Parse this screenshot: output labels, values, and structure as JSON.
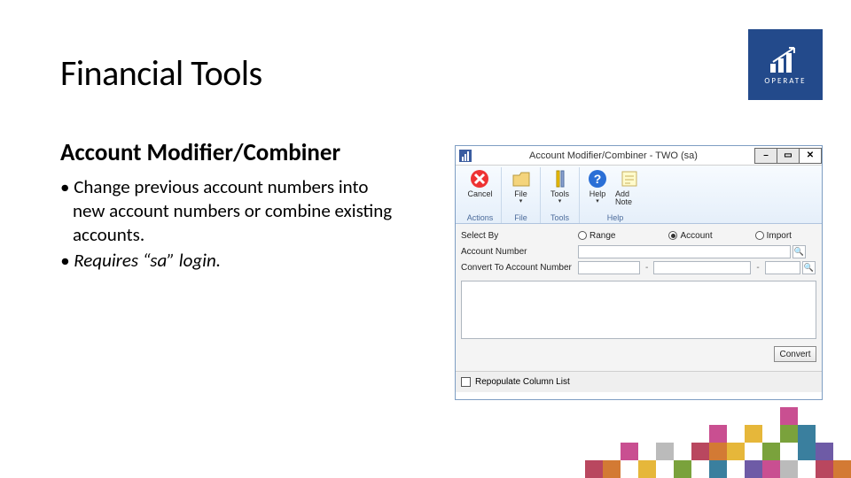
{
  "slide": {
    "title": "Financial Tools",
    "subtitle": "Account Modifier/Combiner",
    "bullet1": "• Change previous account numbers into new account numbers or combine existing accounts.",
    "bullet2": "• Requires “sa” login."
  },
  "brand": {
    "label": "OPERATE"
  },
  "window": {
    "title": "Account Modifier/Combiner - TWO (sa)",
    "min": "–",
    "max": "▭",
    "close": "✕"
  },
  "ribbon": {
    "cancel": "Cancel",
    "file": "File",
    "tools": "Tools",
    "help": "Help",
    "add_note": "Add Note",
    "group_actions": "Actions",
    "group_file": "File",
    "group_tools": "Tools",
    "group_help": "Help",
    "caret": "▾"
  },
  "form": {
    "select_by_label": "Select By",
    "radio_range": "Range",
    "radio_account": "Account",
    "radio_import": "Import",
    "account_number_label": "Account Number",
    "convert_to_label": "Convert To Account Number",
    "dash": "-",
    "convert_button": "Convert",
    "repopulate": "Repopulate Column List",
    "lookup": "🔍"
  }
}
